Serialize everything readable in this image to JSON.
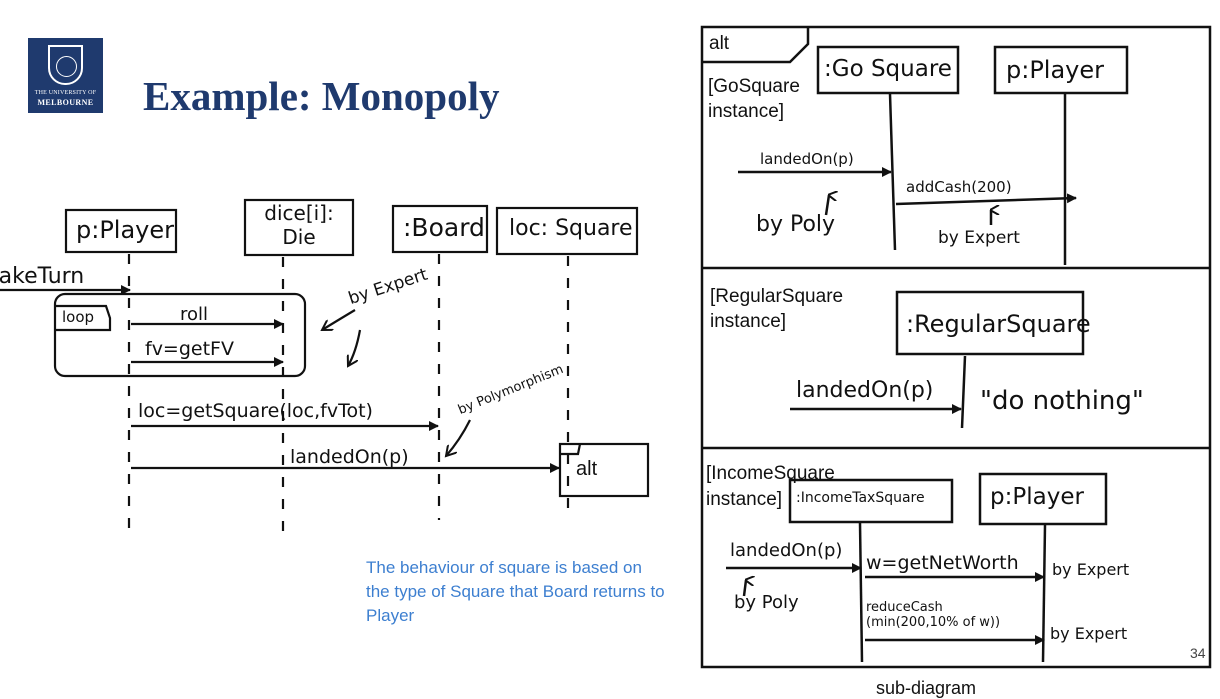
{
  "slide": {
    "title": "Example: Monopoly",
    "logo_line1": "THE UNIVERSITY OF",
    "logo_line2": "MELBOURNE",
    "caption": "The behaviour of square is based on the type of Square that Board returns to Player",
    "page_number": "34",
    "bottom_label": "sub-diagram"
  },
  "main_diagram": {
    "lifelines": [
      "p:Player",
      "dice[i]:\nDie",
      ":Board",
      "loc: Square"
    ],
    "incoming_message": "takeTurn",
    "loop_label": "loop",
    "messages": [
      "roll",
      "fv=getFV",
      "loc=getSquare(loc,fvTot)",
      "landedOn(p)"
    ],
    "notes": [
      "by Expert",
      "by Polymorphism"
    ],
    "alt_label": "alt"
  },
  "sub_diagram": {
    "alt_label": "alt",
    "sections": [
      {
        "guard": "[GoSquare\ninstance]",
        "lifelines": [
          ":Go Square",
          "p:Player"
        ],
        "messages": [
          "landedOn(p)",
          "addCash(200)"
        ],
        "notes": [
          "by Poly",
          "by Expert"
        ]
      },
      {
        "guard": "[RegularSquare\ninstance]",
        "lifelines": [
          ":RegularSquare"
        ],
        "messages": [
          "landedOn(p)"
        ],
        "notes": [
          "\"do nothing\""
        ]
      },
      {
        "guard": "[IncomeSquare\ninstance]",
        "lifelines": [
          ":IncomeTaxSquare",
          "p:Player"
        ],
        "messages": [
          "landedOn(p)",
          "w=getNetWorth",
          "reduceCash\n(min(200,10% of w))"
        ],
        "notes": [
          "by Poly",
          "by Expert",
          "by Expert"
        ]
      }
    ]
  },
  "colors": {
    "title": "#1f3a6e",
    "caption": "#3d7fd0",
    "logo_bg": "#1f3a6e",
    "ink": "#111111"
  }
}
